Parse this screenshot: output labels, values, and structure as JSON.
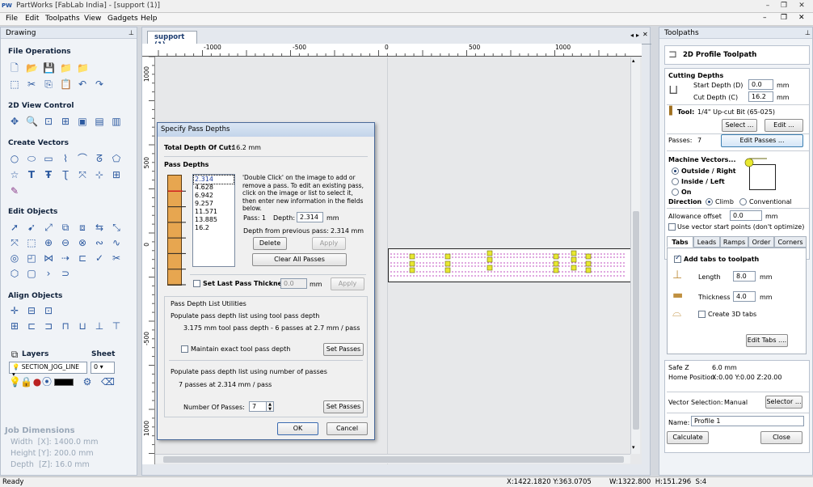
{
  "window": {
    "logo": "PW",
    "title": "PartWorks [FabLab India] - [support (1)]"
  },
  "menu": [
    "File",
    "Edit",
    "Toolpaths",
    "View",
    "Gadgets",
    "Help"
  ],
  "drawing": {
    "title": "Drawing",
    "sections": {
      "file_ops": "File Operations",
      "view_ctrl": "2D View Control",
      "create_vec": "Create Vectors",
      "edit_obj": "Edit Objects",
      "align_obj": "Align Objects",
      "layers": "Layers",
      "sheet": "Sheet"
    },
    "layer_value": "SECTION_JOG_LINE",
    "sheet_value": "0",
    "job": {
      "title": "Job Dimensions",
      "width": "Width  [X]: 1400.0 mm",
      "height": "Height [Y]: 200.0 mm",
      "depth": "Depth  [Z]: 16.0 mm"
    }
  },
  "doc": {
    "tab": "support (1)",
    "ruler_x": [
      "-1000",
      "-500",
      "0",
      "500",
      "1000"
    ],
    "ruler_y": [
      "1000",
      "500",
      "0",
      "-500",
      "1000"
    ]
  },
  "dialog": {
    "title": "Specify Pass Depths",
    "total_label": "Total Depth Of Cut:",
    "total_value": "16.2 mm",
    "pass_depths_head": "Pass Depths",
    "list": [
      "2.314",
      "4.628",
      "6.942",
      "9.257",
      "11.571",
      "13.885",
      "16.2"
    ],
    "help": "'Double Click' on the image to add or remove a pass. To edit an existing pass, click on the image or list to select it, then enter new information in the fields below.",
    "pass_label": "Pass: 1",
    "depth_label": "Depth:",
    "depth_value": "2.314",
    "mm": "mm",
    "prev_label": "Depth from previous pass:",
    "prev_value": "2.314 mm",
    "delete": "Delete",
    "apply": "Apply",
    "clear_all": "Clear All Passes",
    "set_last": "Set Last Pass Thickness",
    "last_value": "0.0",
    "apply2": "Apply",
    "util_head": "Pass Depth List Utilities",
    "tool_head": "Populate pass depth list using tool pass depth",
    "tool_info": "3.175 mm tool pass depth - 6 passes at 2.7 mm / pass",
    "maintain": "Maintain exact tool pass depth",
    "set_passes": "Set Passes",
    "num_head": "Populate pass depth list using number of passes",
    "num_info": "7 passes at 2.314 mm / pass",
    "num_label": "Number Of Passes:",
    "num_value": "7",
    "ok": "OK",
    "cancel": "Cancel"
  },
  "toolpaths": {
    "title": "Toolpaths",
    "heading": "2D Profile Toolpath",
    "cutting": "Cutting Depths",
    "start_label": "Start Depth (D)",
    "start_value": "0.0",
    "cut_label": "Cut Depth (C)",
    "cut_value": "16.2",
    "mm": "mm",
    "tool_label": "Tool:",
    "tool_value": "1/4\" Up-cut Bit (65-025)",
    "select": "Select ...",
    "edit": "Edit ...",
    "passes_label": "Passes:",
    "passes_value": "7",
    "edit_passes": "Edit Passes ...",
    "mv_head": "Machine Vectors...",
    "outside": "Outside / Right",
    "inside": "Inside / Left",
    "on": "On",
    "direction": "Direction",
    "climb": "Climb",
    "conventional": "Conventional",
    "allowance_label": "Allowance offset",
    "allowance_value": "0.0",
    "use_start": "Use vector start points (don't optimize)",
    "tabs": [
      "Tabs",
      "Leads",
      "Ramps",
      "Order",
      "Corners"
    ],
    "add_tabs": "Add tabs to toolpath",
    "length_label": "Length",
    "length_value": "8.0",
    "thick_label": "Thickness",
    "thick_value": "4.0",
    "create3d": "Create 3D tabs",
    "edit_tabs": "Edit Tabs ....",
    "safez_label": "Safe Z",
    "safez_value": "6.0 mm",
    "home_label": "Home Position",
    "home_value": "X:0.00 Y:0.00 Z:20.00",
    "vecsel_label": "Vector Selection:",
    "vecsel_value": "Manual",
    "selector": "Selector ...",
    "name_label": "Name:",
    "name_value": "Profile 1",
    "calculate": "Calculate",
    "close": "Close"
  },
  "status": {
    "ready": "Ready",
    "coords": "X:1422.1820 Y:363.0705",
    "size": "W:1322.800  H:151.296  S:4"
  }
}
